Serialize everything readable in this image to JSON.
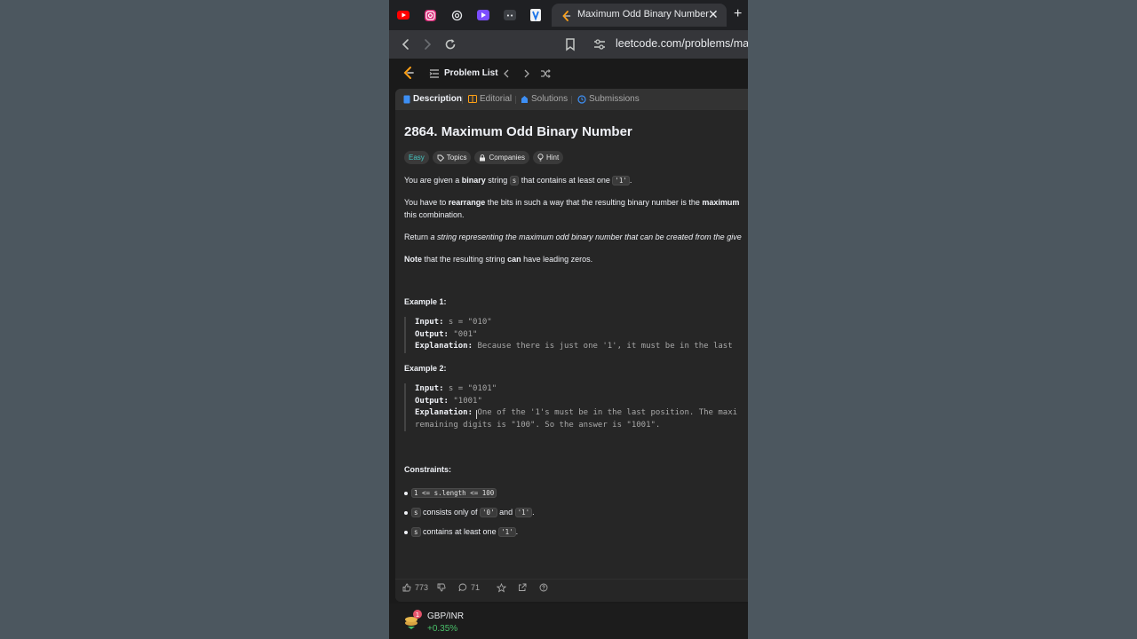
{
  "browser": {
    "active_tab_title": "Maximum Odd Binary Number",
    "url": "leetcode.com/problems/max",
    "pinned_tabs": [
      "youtube-icon",
      "instagram-icon",
      "openai-icon",
      "video-icon",
      "game-icon",
      "vercel-icon"
    ]
  },
  "nav": {
    "problem_list": "Problem List"
  },
  "tabs": [
    "Description",
    "Editorial",
    "Solutions",
    "Submissions"
  ],
  "problem": {
    "title": "2864. Maximum Odd Binary Number",
    "difficulty": "Easy",
    "tags": [
      "Topics",
      "Companies",
      "Hint"
    ],
    "p1": {
      "a": "You are given a ",
      "b": "binary",
      "c": " string ",
      "code1": "s",
      "d": " that contains at least one ",
      "code2": "'1'",
      "e": "."
    },
    "p2": {
      "a": "You have to ",
      "b": "rearrange",
      "c": " the bits in such a way that the resulting binary number is the ",
      "d": "maximum",
      "line2": "this combination."
    },
    "p3": {
      "a": "Return ",
      "i": "a string representing the maximum odd binary number that can be created from the give"
    },
    "p4": {
      "b": "Note",
      "a": " that the resulting string ",
      "b2": "can",
      "c": " have leading zeros."
    },
    "example1": {
      "head": "Example 1:",
      "input_label": "Input:",
      "input": " s = \"010\"",
      "output_label": "Output:",
      "output": " \"001\"",
      "expl_label": "Explanation:",
      "expl": " Because there is just one '1', it must be in the last"
    },
    "example2": {
      "head": "Example 2:",
      "input_label": "Input:",
      "input": " s = \"0101\"",
      "output_label": "Output:",
      "output": " \"1001\"",
      "expl_label": "Explanation:",
      "expl": " One of the '1's must be in the last position. The maxi",
      "expl2": "remaining digits is \"100\". So the answer is \"1001\"."
    },
    "constraints": {
      "head": "Constraints:",
      "c1_code": "1 <= s.length <= 100",
      "c2_code1": "s",
      "c2_a": " consists only of ",
      "c2_code2": "'0'",
      "c2_b": " and ",
      "c2_code3": "'1'",
      "c2_c": ".",
      "c3_code1": "s",
      "c3_a": " contains at least one ",
      "c3_code2": "'1'",
      "c3_b": "."
    }
  },
  "footer": {
    "likes": "773",
    "comments": "71"
  },
  "ticker": {
    "name": "GBP/INR",
    "change": "+0.35%",
    "badge": "1"
  },
  "colors": {
    "easy": "#46c6c2",
    "positive": "#49c06a",
    "accent_blue": "#3d8ff5"
  }
}
